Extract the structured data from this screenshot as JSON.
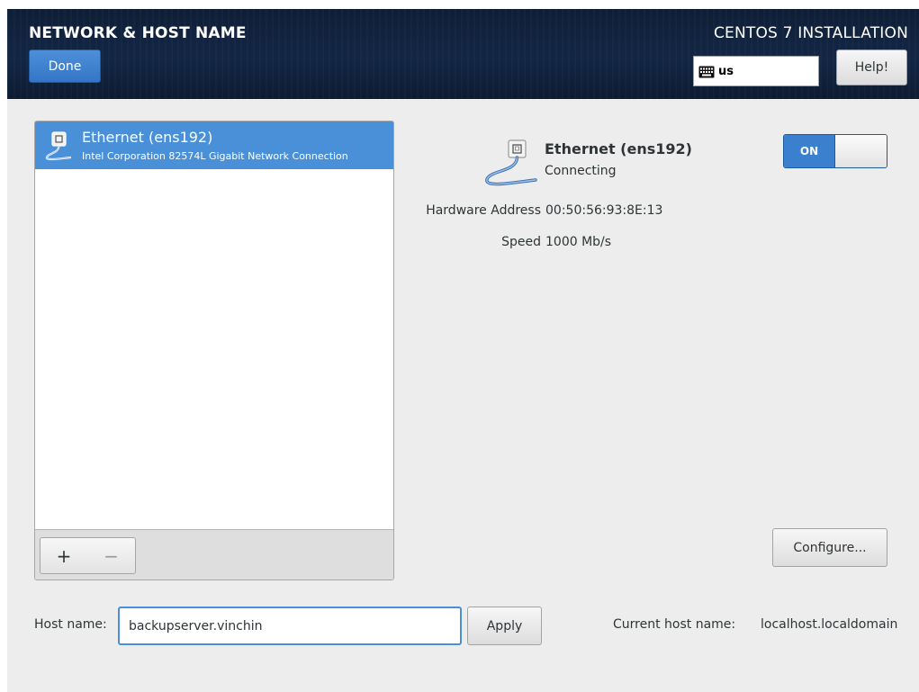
{
  "header": {
    "page_title": "NETWORK & HOST NAME",
    "done_label": "Done",
    "install_title": "CENTOS 7 INSTALLATION",
    "keyboard_layout": "us",
    "help_label": "Help!",
    "icons": {
      "keyboard": "keyboard-icon"
    }
  },
  "devices": [
    {
      "name": "Ethernet (ens192)",
      "description": "Intel Corporation 82574L Gigabit Network Connection",
      "selected": true,
      "icon": "ethernet-cable-icon"
    }
  ],
  "list_toolbar": {
    "add_label": "+",
    "remove_label": "−"
  },
  "detail": {
    "name": "Ethernet (ens192)",
    "status": "Connecting",
    "icon": "ethernet-cable-icon",
    "toggle_label": "ON",
    "toggle_state": true,
    "fields": [
      {
        "label": "Hardware Address",
        "value": "00:50:56:93:8E:13"
      },
      {
        "label": "Speed",
        "value": "1000 Mb/s"
      }
    ],
    "configure_label": "Configure..."
  },
  "hostname": {
    "label": "Host name:",
    "value": "backupserver.vinchin",
    "apply_label": "Apply",
    "current_label": "Current host name:",
    "current_value": "localhost.localdomain"
  },
  "colors": {
    "accent": "#4a90d9",
    "header_bg": "#122645",
    "window_bg": "#ededed"
  }
}
